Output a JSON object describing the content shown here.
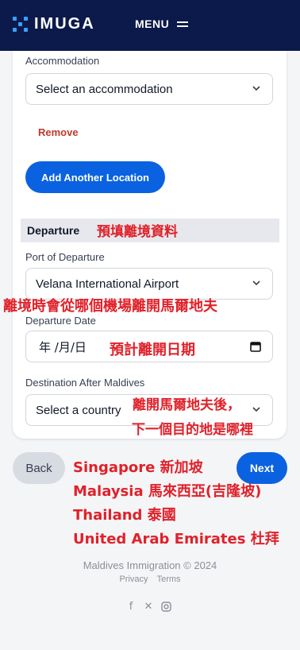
{
  "header": {
    "logo_text": "IMUGA",
    "menu_label": "MENU"
  },
  "form": {
    "accommodation_label": "Accommodation",
    "accommodation_value": "Select an accommodation",
    "remove_label": "Remove",
    "add_location_label": "Add Another Location",
    "departure_section_title": "Departure",
    "port_label": "Port of Departure",
    "port_value": "Velana International Airport",
    "date_label": "Departure Date",
    "date_value": "年 /月/日",
    "destination_label": "Destination After Maldives",
    "destination_value": "Select a country"
  },
  "annotations": {
    "departure_note": "預填離境資料",
    "port_note": "離境時會從哪個機場離開馬爾地夫",
    "date_note": "預計離開日期",
    "destination_note_line1": "離開馬爾地夫後，",
    "destination_note_line2": "下一個目的地是哪裡",
    "examples": [
      "Singapore 新加坡",
      "Malaysia 馬來西亞(吉隆坡)",
      "Thailand 泰國",
      "United Arab Emirates 杜拜"
    ],
    "color": "#e0212a"
  },
  "nav": {
    "back_label": "Back",
    "next_label": "Next"
  },
  "footer": {
    "copyright": "Maldives Immigration © 2024",
    "privacy": "Privacy",
    "terms": "Terms",
    "social_icons": [
      "facebook-icon",
      "x-icon",
      "instagram-icon"
    ]
  },
  "colors": {
    "brand_navy": "#0b1a4a",
    "primary_blue": "#0a62e0",
    "remove_red": "#c0392b"
  }
}
